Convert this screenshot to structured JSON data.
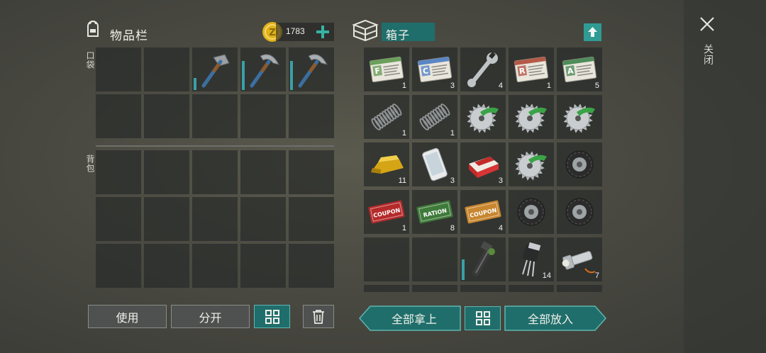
{
  "inventory": {
    "title": "物品栏",
    "coins": "1783",
    "pocket_label": "口袋",
    "backpack_label": "背包",
    "pocket": [
      {
        "item": "hammer-icon",
        "count": "",
        "dur": 0.3
      },
      {
        "item": "pickaxe-icon",
        "count": "",
        "dur": 0.7
      },
      {
        "item": "pickaxe-icon",
        "count": "",
        "dur": 0.7
      }
    ]
  },
  "box": {
    "title": "箱子",
    "items": [
      {
        "item": "army-card-icon",
        "letter": "F",
        "tint": "#6aa05a",
        "count": "1"
      },
      {
        "item": "army-card-icon",
        "letter": "C",
        "tint": "#5a86c4",
        "count": "3"
      },
      {
        "item": "wrench-icon",
        "count": "4"
      },
      {
        "item": "army-card-icon",
        "letter": "R",
        "tint": "#b45a48",
        "count": "1"
      },
      {
        "item": "army-card-icon",
        "letter": "A",
        "tint": "#4f8c5a",
        "count": "5"
      },
      {
        "item": "spring-icon",
        "count": "1"
      },
      {
        "item": "spring-icon",
        "count": "1"
      },
      {
        "item": "saw-blade-icon",
        "count": ""
      },
      {
        "item": "saw-blade-icon",
        "count": ""
      },
      {
        "item": "saw-blade-icon",
        "count": ""
      },
      {
        "item": "gold-bar-icon",
        "count": "11"
      },
      {
        "item": "smartphone-icon",
        "count": "3"
      },
      {
        "item": "cigarette-pack-icon",
        "count": "3"
      },
      {
        "item": "saw-blade-icon",
        "count": ""
      },
      {
        "item": "tire-icon",
        "count": ""
      },
      {
        "item": "coupon-icon",
        "tint": "#b52a2a",
        "text": "COUPON",
        "count": "1"
      },
      {
        "item": "coupon-icon",
        "tint": "#3f7a3a",
        "text": "RATION",
        "count": "8"
      },
      {
        "item": "coupon-icon",
        "tint": "#c7862f",
        "text": "COUPON",
        "count": "4"
      },
      {
        "item": "tire-icon",
        "count": ""
      },
      {
        "item": "tire-icon",
        "count": ""
      },
      {
        "item": "empty",
        "count": ""
      },
      {
        "item": "empty",
        "count": ""
      },
      {
        "item": "chainsaw-icon",
        "count": "",
        "dur": 0.5
      },
      {
        "item": "transistor-icon",
        "count": "14"
      },
      {
        "item": "flashlight-icon",
        "count": "7"
      }
    ]
  },
  "buttons": {
    "use": "使用",
    "split": "分开",
    "take_all": "全部拿上",
    "put_all": "全部放入"
  },
  "close_label": "关闭",
  "colors": {
    "accent": "#1f6e6b",
    "teal_border": "#5fb5b0",
    "coin": "#e0b21c"
  }
}
